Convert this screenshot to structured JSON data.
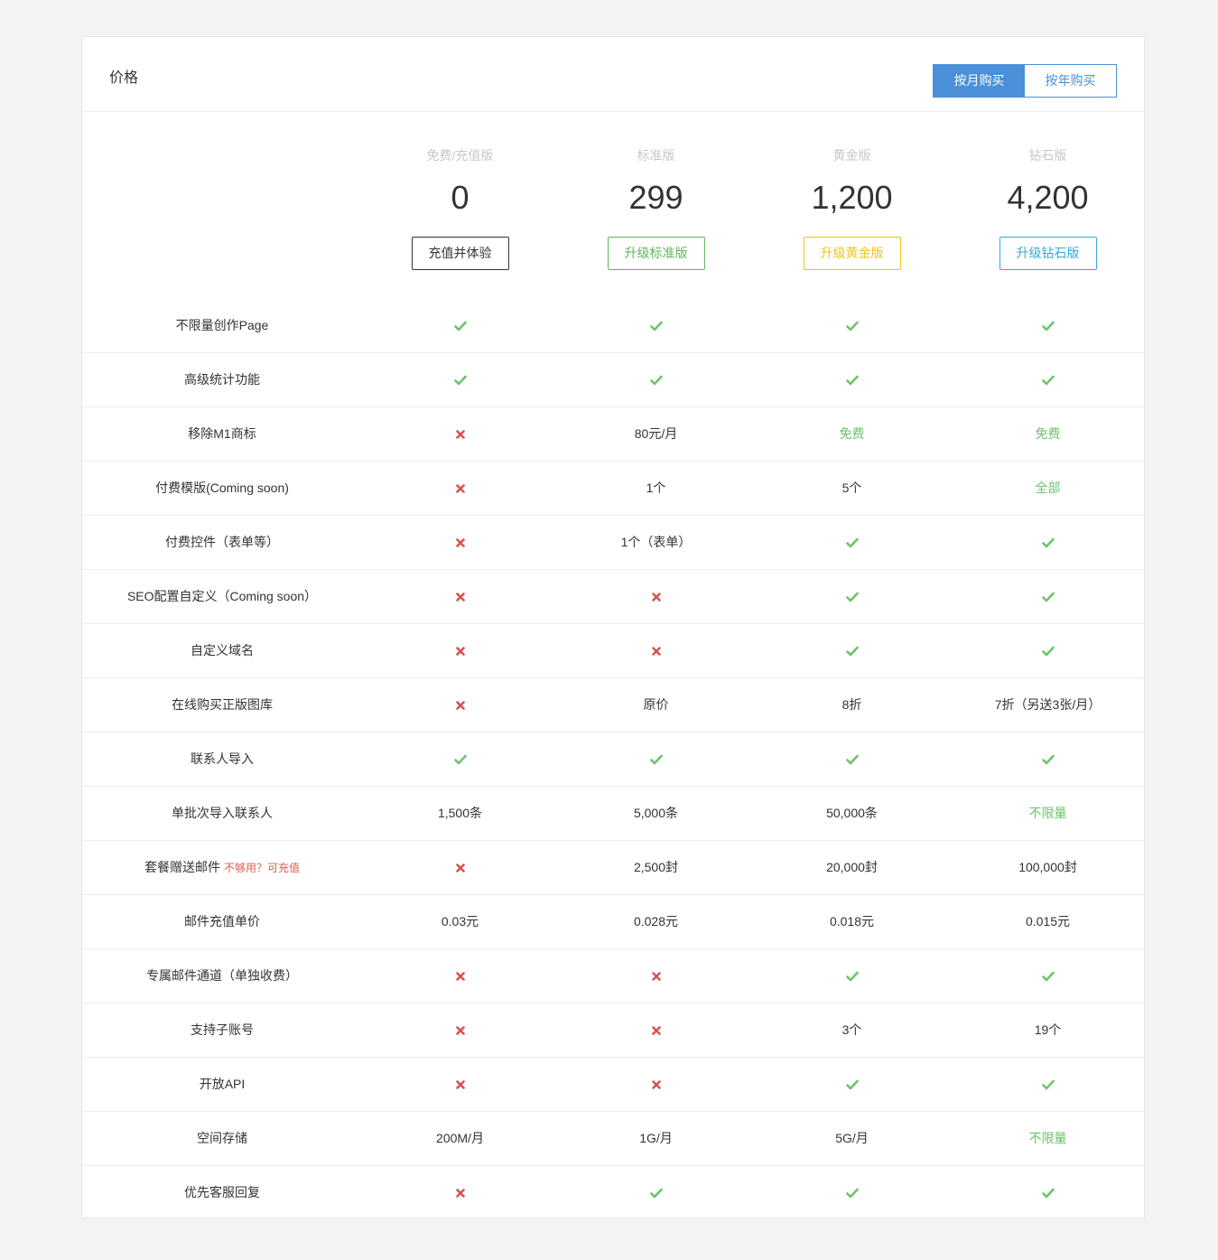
{
  "header": {
    "title": "价格",
    "toggle": {
      "monthly_label": "按月购买",
      "yearly_label": "按年购买",
      "selected": "monthly"
    }
  },
  "colors": {
    "accent": "#4a90d9",
    "check": "#6cc36c",
    "cross": "#d9534f",
    "note": "#e05b4b"
  },
  "plans": [
    {
      "name": "免费/充值版",
      "price": "0",
      "button_label": "充值并体验",
      "button_color": "#333333"
    },
    {
      "name": "标准版",
      "price": "299",
      "button_label": "升级标准版",
      "button_color": "#5cb85c"
    },
    {
      "name": "黄金版",
      "price": "1,200",
      "button_label": "升级黄金版",
      "button_color": "#f0c419"
    },
    {
      "name": "钻石版",
      "price": "4,200",
      "button_label": "升级钻石版",
      "button_color": "#38a8d8"
    }
  ],
  "features": [
    {
      "label": "不限量创作Page",
      "values": [
        {
          "type": "check"
        },
        {
          "type": "check"
        },
        {
          "type": "check"
        },
        {
          "type": "check"
        }
      ]
    },
    {
      "label": "高级统计功能",
      "values": [
        {
          "type": "check"
        },
        {
          "type": "check"
        },
        {
          "type": "check"
        },
        {
          "type": "check"
        }
      ]
    },
    {
      "label": "移除M1商标",
      "values": [
        {
          "type": "cross"
        },
        {
          "type": "text",
          "text": "80元/月"
        },
        {
          "type": "text",
          "text": "免费",
          "highlight": true
        },
        {
          "type": "text",
          "text": "免费",
          "highlight": true
        }
      ]
    },
    {
      "label": "付费模版(Coming soon)",
      "values": [
        {
          "type": "cross"
        },
        {
          "type": "text",
          "text": "1个"
        },
        {
          "type": "text",
          "text": "5个"
        },
        {
          "type": "text",
          "text": "全部",
          "highlight": true
        }
      ]
    },
    {
      "label": "付费控件（表单等）",
      "values": [
        {
          "type": "cross"
        },
        {
          "type": "text",
          "text": "1个（表单）"
        },
        {
          "type": "check"
        },
        {
          "type": "check"
        }
      ]
    },
    {
      "label": "SEO配置自定义（Coming soon）",
      "values": [
        {
          "type": "cross"
        },
        {
          "type": "cross"
        },
        {
          "type": "check"
        },
        {
          "type": "check"
        }
      ]
    },
    {
      "label": "自定义域名",
      "values": [
        {
          "type": "cross"
        },
        {
          "type": "cross"
        },
        {
          "type": "check"
        },
        {
          "type": "check"
        }
      ]
    },
    {
      "label": "在线购买正版图库",
      "values": [
        {
          "type": "cross"
        },
        {
          "type": "text",
          "text": "原价"
        },
        {
          "type": "text",
          "text": "8折"
        },
        {
          "type": "text",
          "text": "7折（另送3张/月）"
        }
      ]
    },
    {
      "label": "联系人导入",
      "values": [
        {
          "type": "check"
        },
        {
          "type": "check"
        },
        {
          "type": "check"
        },
        {
          "type": "check"
        }
      ]
    },
    {
      "label": "单批次导入联系人",
      "values": [
        {
          "type": "text",
          "text": "1,500条"
        },
        {
          "type": "text",
          "text": "5,000条"
        },
        {
          "type": "text",
          "text": "50,000条"
        },
        {
          "type": "text",
          "text": "不限量",
          "highlight": true
        }
      ]
    },
    {
      "label": "套餐赠送邮件",
      "note": "不够用？可充值",
      "values": [
        {
          "type": "cross"
        },
        {
          "type": "text",
          "text": "2,500封"
        },
        {
          "type": "text",
          "text": "20,000封"
        },
        {
          "type": "text",
          "text": "100,000封"
        }
      ]
    },
    {
      "label": "邮件充值单价",
      "values": [
        {
          "type": "text",
          "text": "0.03元"
        },
        {
          "type": "text",
          "text": "0.028元"
        },
        {
          "type": "text",
          "text": "0.018元"
        },
        {
          "type": "text",
          "text": "0.015元"
        }
      ]
    },
    {
      "label": "专属邮件通道（单独收费）",
      "values": [
        {
          "type": "cross"
        },
        {
          "type": "cross"
        },
        {
          "type": "check"
        },
        {
          "type": "check"
        }
      ]
    },
    {
      "label": "支持子账号",
      "values": [
        {
          "type": "cross"
        },
        {
          "type": "cross"
        },
        {
          "type": "text",
          "text": "3个"
        },
        {
          "type": "text",
          "text": "19个"
        }
      ]
    },
    {
      "label": "开放API",
      "values": [
        {
          "type": "cross"
        },
        {
          "type": "cross"
        },
        {
          "type": "check"
        },
        {
          "type": "check"
        }
      ]
    },
    {
      "label": "空间存储",
      "values": [
        {
          "type": "text",
          "text": "200M/月"
        },
        {
          "type": "text",
          "text": "1G/月"
        },
        {
          "type": "text",
          "text": "5G/月"
        },
        {
          "type": "text",
          "text": "不限量",
          "highlight": true
        }
      ]
    },
    {
      "label": "优先客服回复",
      "values": [
        {
          "type": "cross"
        },
        {
          "type": "check"
        },
        {
          "type": "check"
        },
        {
          "type": "check"
        }
      ]
    }
  ]
}
